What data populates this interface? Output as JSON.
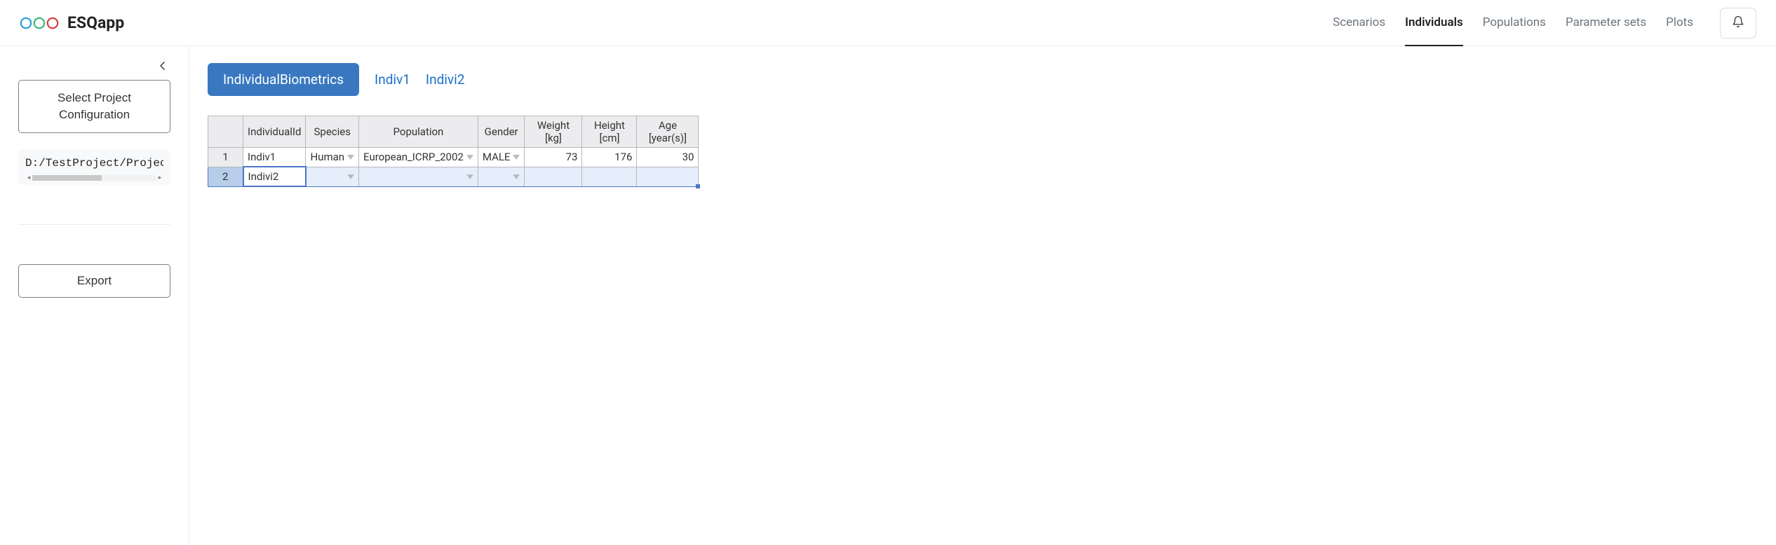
{
  "app_name": "ESQapp",
  "nav": {
    "items": [
      "Scenarios",
      "Individuals",
      "Populations",
      "Parameter sets",
      "Plots"
    ],
    "active": "Individuals"
  },
  "sidebar": {
    "select_project_label": "Select Project Configuration",
    "path_text": "D:/TestProject/ProjectC",
    "export_label": "Export"
  },
  "tabs": {
    "items": [
      "IndividualBiometrics",
      "Indiv1",
      "Indivi2"
    ],
    "active": "IndividualBiometrics"
  },
  "table": {
    "columns": [
      "IndividualId",
      "Species",
      "Population",
      "Gender",
      "Weight [kg]",
      "Height [cm]",
      "Age [year(s)]"
    ],
    "rows": [
      {
        "num": "1",
        "IndividualId": "Indiv1",
        "Species": "Human",
        "Population": "European_ICRP_2002",
        "Gender": "MALE",
        "Weight": "73",
        "Height": "176",
        "Age": "30",
        "selected": false
      },
      {
        "num": "2",
        "IndividualId": "Indivi2",
        "Species": "",
        "Population": "",
        "Gender": "",
        "Weight": "",
        "Height": "",
        "Age": "",
        "selected": true
      }
    ]
  }
}
